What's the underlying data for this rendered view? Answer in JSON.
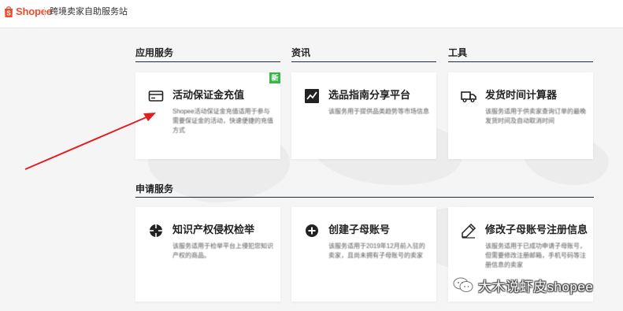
{
  "header": {
    "logo_text": "Shopee",
    "site_title": "跨境卖家自助服务站"
  },
  "sections": {
    "app_services": {
      "title": "应用服务"
    },
    "news": {
      "title": "资讯"
    },
    "tools": {
      "title": "工具"
    },
    "apply_services": {
      "title": "申请服务"
    }
  },
  "cards": {
    "deposit": {
      "title": "活动保证金充值",
      "desc": "Shopee活动保证金充值适用于参与需要保证金的活动，快速便捷的充值方式",
      "badge": "新",
      "icon": "card-icon"
    },
    "product_guide": {
      "title": "选品指南分享平台",
      "desc": "该服务用于提供品类趋势等市场信息",
      "icon": "trend-chart-icon"
    },
    "shipping_calc": {
      "title": "发货时间计算器",
      "desc": "该服务适用于供卖家查询订单的最晚发货时间及自动取消时间",
      "icon": "truck-icon"
    },
    "ip_report": {
      "title": "知识产权侵权检举",
      "desc": "该服务适用于检举平台上侵犯您知识产权的商品。",
      "icon": "crosshair-icon"
    },
    "create_sub": {
      "title": "创建子母账号",
      "desc": "该服务适用于2019年12月前入驻的卖家，且尚未拥有子母账号的卖家",
      "icon": "plus-circle-icon"
    },
    "modify_sub": {
      "title": "修改子母账号注册信息",
      "desc": "该服务适用于已成功申请子母账号，但需要修改注册邮箱，手机号码等注册信息的卖家",
      "icon": "pencil-icon"
    }
  },
  "watermark": {
    "text": "大木说虾皮shopee",
    "icon": "wechat-icon"
  },
  "colors": {
    "brand": "#ee4d2d",
    "badge": "#3bb54a",
    "arrow": "#e02020",
    "section_line": "#1f2b3a"
  }
}
